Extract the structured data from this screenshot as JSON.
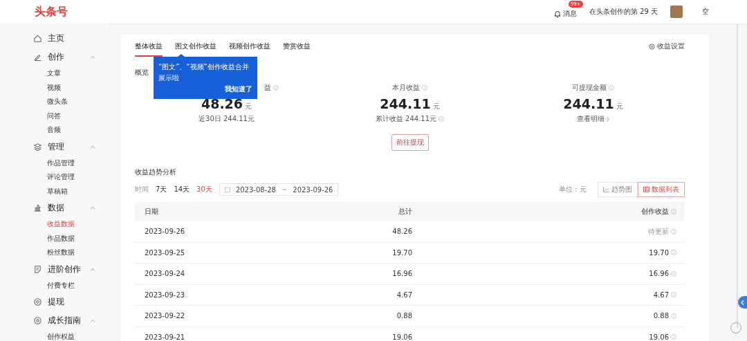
{
  "header": {
    "logo": "头条号",
    "badge": "99+",
    "messages": "消息",
    "days": "在头条创作的第 29 天",
    "user_name": "空"
  },
  "sidebar": {
    "items": [
      {
        "label": "主页",
        "kind": "home"
      },
      {
        "label": "创作",
        "kind": "pen",
        "expanded": true,
        "children": [
          {
            "label": "文章",
            "selected": false
          },
          {
            "label": "视频",
            "selected": false
          },
          {
            "label": "微头条",
            "selected": false
          },
          {
            "label": "问答",
            "selected": false
          },
          {
            "label": "音频",
            "selected": false
          }
        ]
      },
      {
        "label": "管理",
        "kind": "layers",
        "expanded": true,
        "children": [
          {
            "label": "作品管理",
            "selected": false
          },
          {
            "label": "评论管理",
            "selected": false
          },
          {
            "label": "草稿箱",
            "selected": false
          }
        ]
      },
      {
        "label": "数据",
        "kind": "chart",
        "expanded": true,
        "children": [
          {
            "label": "收益数据",
            "selected": true
          },
          {
            "label": "作品数据",
            "selected": false
          },
          {
            "label": "粉丝数据",
            "selected": false
          }
        ]
      },
      {
        "label": "进阶创作",
        "kind": "note",
        "expanded": true,
        "children": [
          {
            "label": "付费专栏",
            "selected": false
          }
        ]
      },
      {
        "label": "提现",
        "kind": "coin"
      },
      {
        "label": "成长指南",
        "kind": "guide",
        "expanded": true,
        "children": [
          {
            "label": "创作权益",
            "selected": false
          }
        ]
      }
    ]
  },
  "tabs": [
    {
      "label": "整体收益",
      "selected": true
    },
    {
      "label": "图文创作收益",
      "selected": false
    },
    {
      "label": "视频创作收益",
      "selected": false
    },
    {
      "label": "赞赏收益",
      "selected": false
    }
  ],
  "settings": "收益设置",
  "tooltip": {
    "text": "“图文”、“视频”创作收益合并展示啦",
    "button": "我知道了"
  },
  "overview": {
    "title": "概览",
    "stats": [
      {
        "label": "益",
        "value": "48.26",
        "unit": "元",
        "sub": "近30日 244.11元",
        "sub_info": false,
        "sub_link": false
      },
      {
        "label": "本月收益",
        "value": "244.11",
        "unit": "元",
        "sub": "累计收益 244.11元",
        "sub_info": true,
        "sub_link": false
      },
      {
        "label": "可提现金额",
        "value": "244.11",
        "unit": "元",
        "sub": "查看明细",
        "sub_info": false,
        "sub_link": true
      }
    ],
    "withdraw": "前往提现"
  },
  "trend": {
    "title": "收益趋势分析",
    "time_label": "时间",
    "ranges": [
      {
        "label": "7天",
        "selected": false
      },
      {
        "label": "14天",
        "selected": false
      },
      {
        "label": "30天",
        "selected": true
      }
    ],
    "date_from": "2023-08-28",
    "date_sep": "~",
    "date_to": "2023-09-26",
    "unit": "单位：元",
    "views": [
      {
        "label": "趋势图",
        "kind": "chart",
        "selected": false
      },
      {
        "label": "数据列表",
        "kind": "table",
        "selected": true
      }
    ]
  },
  "table": {
    "columns": [
      "日期",
      "总计",
      "创作收益"
    ],
    "rows": [
      {
        "date": "2023-09-26",
        "total": "48.26",
        "creation": "待更新",
        "pending": true
      },
      {
        "date": "2023-09-25",
        "total": "19.70",
        "creation": "19.70",
        "pending": false
      },
      {
        "date": "2023-09-24",
        "total": "16.96",
        "creation": "16.96",
        "pending": false
      },
      {
        "date": "2023-09-23",
        "total": "4.67",
        "creation": "4.67",
        "pending": false
      },
      {
        "date": "2023-09-22",
        "total": "0.88",
        "creation": "0.88",
        "pending": false
      },
      {
        "date": "2023-09-21",
        "total": "19.06",
        "creation": "19.06",
        "pending": false
      }
    ]
  }
}
